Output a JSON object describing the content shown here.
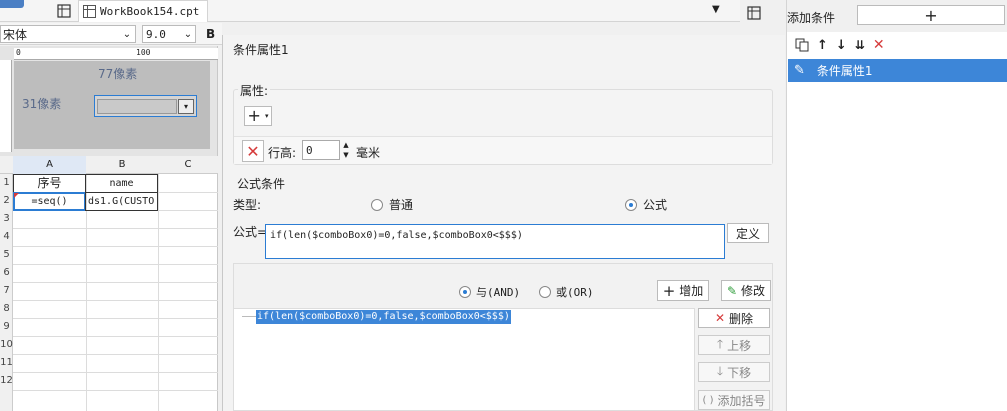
{
  "top_tab": {
    "title": "WorkBook154.cpt"
  },
  "toolbar": {
    "font_name": "宋体",
    "font_size": "9.0",
    "zoom": "100",
    "bold": "B"
  },
  "designer": {
    "width_label": "77像素",
    "height_label": "31像素"
  },
  "sheet": {
    "columns": [
      "A",
      "B",
      "C"
    ],
    "rows": [
      "1",
      "2",
      "3",
      "4",
      "5",
      "6",
      "7",
      "8",
      "9",
      "10",
      "11",
      "12"
    ],
    "cells": {
      "a1": "序号",
      "b1": "name",
      "a2": "=seq()",
      "b2": "ds1.G(CUSTO"
    }
  },
  "dialog": {
    "title": "条件属性1",
    "attr_section": "属性:",
    "row_height_label": "行高:",
    "row_height_value": "0",
    "unit": "毫米",
    "formula_section": "公式条件",
    "type_label": "类型:",
    "type_normal": "普通",
    "type_formula": "公式",
    "formula_label": "公式=",
    "formula_value": "if(len($comboBox0)=0,false,$comboBox0<$$$)",
    "define_button": "定义",
    "and_label": "与(AND)",
    "or_label": "或(OR)",
    "add_button": "增加",
    "modify_button": "修改",
    "condition_item": "if(len($comboBox0)=0,false,$comboBox0<$$$)",
    "delete_button": "删除",
    "up_button": "上移",
    "down_button": "下移",
    "bracket_button": "添加括号"
  },
  "right_panel": {
    "header_label": "添加条件",
    "add_symbol": "+",
    "list_item": "条件属性1"
  },
  "colors": {
    "accent": "#2b7cd3",
    "danger": "#d63b3b",
    "selection": "#3d86d8"
  }
}
